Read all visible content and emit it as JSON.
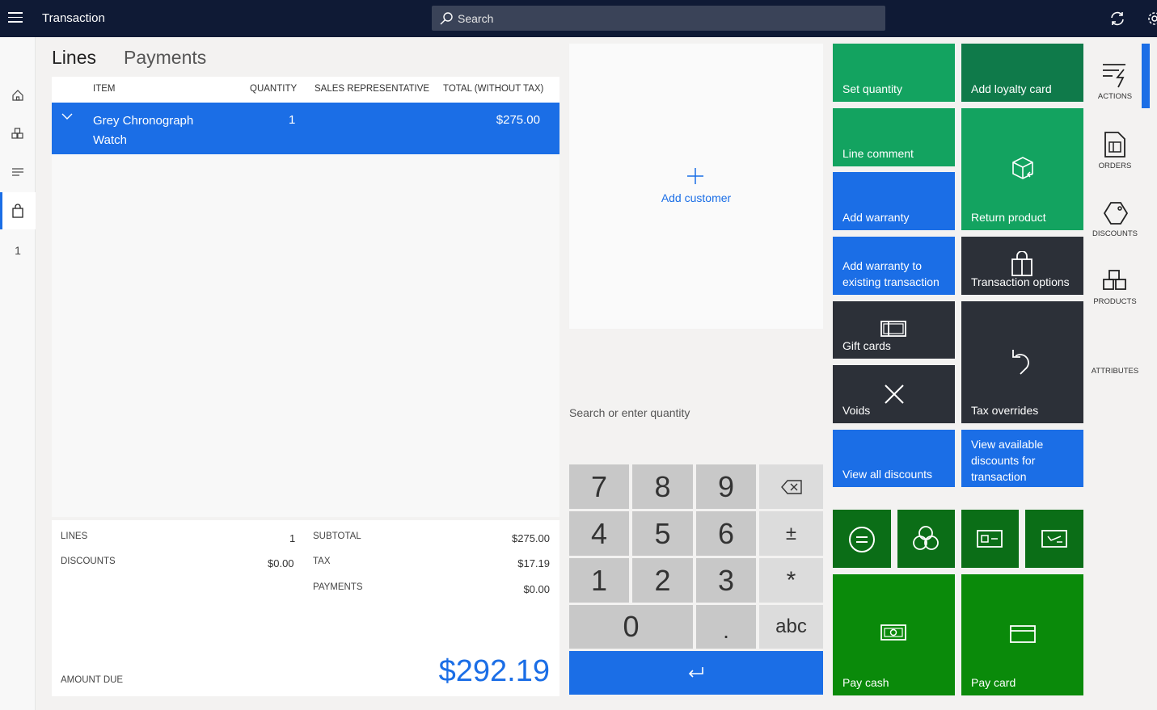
{
  "header": {
    "title": "Transaction",
    "search_placeholder": "Search"
  },
  "left_rail": {
    "badge_count": "1"
  },
  "tabs": {
    "lines": "Lines",
    "payments": "Payments"
  },
  "grid": {
    "columns": [
      "ITEM",
      "QUANTITY",
      "SALES REPRESENTATIVE",
      "TOTAL (WITHOUT TAX)"
    ],
    "rows": [
      {
        "item": "Grey Chronograph Watch",
        "quantity": "1",
        "sales_rep": "",
        "total": "$275.00"
      }
    ]
  },
  "totals": {
    "lines_label": "LINES",
    "lines_value": "1",
    "discounts_label": "DISCOUNTS",
    "discounts_value": "$0.00",
    "subtotal_label": "SUBTOTAL",
    "subtotal_value": "$275.00",
    "tax_label": "TAX",
    "tax_value": "$17.19",
    "payments_label": "PAYMENTS",
    "payments_value": "$0.00",
    "amount_due_label": "AMOUNT DUE",
    "amount_due_value": "$292.19"
  },
  "customer": {
    "add_label": "Add customer"
  },
  "numpad": {
    "label": "Search or enter quantity",
    "keys": [
      "7",
      "8",
      "9",
      "4",
      "5",
      "6",
      "1",
      "2",
      "3",
      "0",
      ".",
      "±",
      "*",
      "abc"
    ]
  },
  "tiles": {
    "set_quantity": "Set quantity",
    "add_loyalty_card": "Add loyalty card",
    "line_comment": "Line comment",
    "return_product": "Return product",
    "add_warranty": "Add warranty",
    "add_warranty_existing": "Add warranty to existing transaction",
    "transaction_options": "Transaction options",
    "gift_cards": "Gift cards",
    "voids": "Voids",
    "tax_overrides": "Tax overrides",
    "view_all_discounts": "View all discounts",
    "view_available_discounts": "View available discounts for transaction",
    "pay_cash": "Pay cash",
    "pay_card": "Pay card"
  },
  "right_rail": {
    "actions": "ACTIONS",
    "orders": "ORDERS",
    "discounts": "DISCOUNTS",
    "products": "PRODUCTS",
    "attributes": "ATTRIBUTES"
  },
  "colors": {
    "accent": "#1b6ee6",
    "topbar": "#0f1a35",
    "tile_green": "#13a360",
    "tile_dark_green": "#0f7a4a",
    "tile_dark": "#2c3038",
    "pay_green": "#0a8a0a"
  }
}
